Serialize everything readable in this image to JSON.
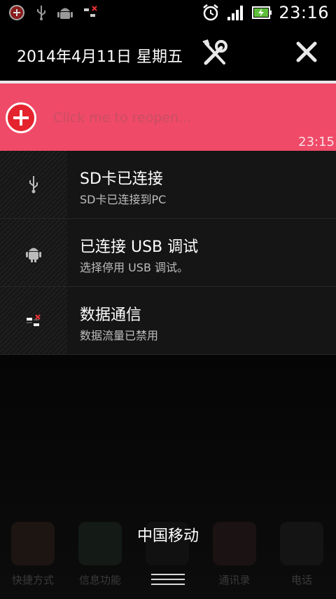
{
  "status_bar": {
    "time": "23:16",
    "icons_left": [
      "plus-circle-icon",
      "usb-icon",
      "android-icon",
      "data-off-icon"
    ],
    "icons_right": [
      "alarm-icon",
      "signal-icon",
      "battery-charging-icon"
    ]
  },
  "header": {
    "date": "2014年4月11日 星期五",
    "settings_icon": "wrench-screwdriver-icon",
    "close_icon": "close-icon"
  },
  "banner": {
    "text": "Click me to reopen...",
    "time": "23:15",
    "color": "#ef4a68"
  },
  "notifications": [
    {
      "icon": "usb-icon",
      "title": "SD卡已连接",
      "subtitle": "SD卡已连接到PC"
    },
    {
      "icon": "android-icon",
      "title": "已连接 USB 调试",
      "subtitle": "选择停用 USB 调试。"
    },
    {
      "icon": "data-off-icon",
      "title": "数据通信",
      "subtitle": "数据流量已禁用"
    }
  ],
  "carrier": "中国移动",
  "dock": [
    {
      "label": "快捷方式"
    },
    {
      "label": "信息功能"
    },
    {
      "label": ""
    },
    {
      "label": "通讯录"
    },
    {
      "label": "电话"
    }
  ]
}
